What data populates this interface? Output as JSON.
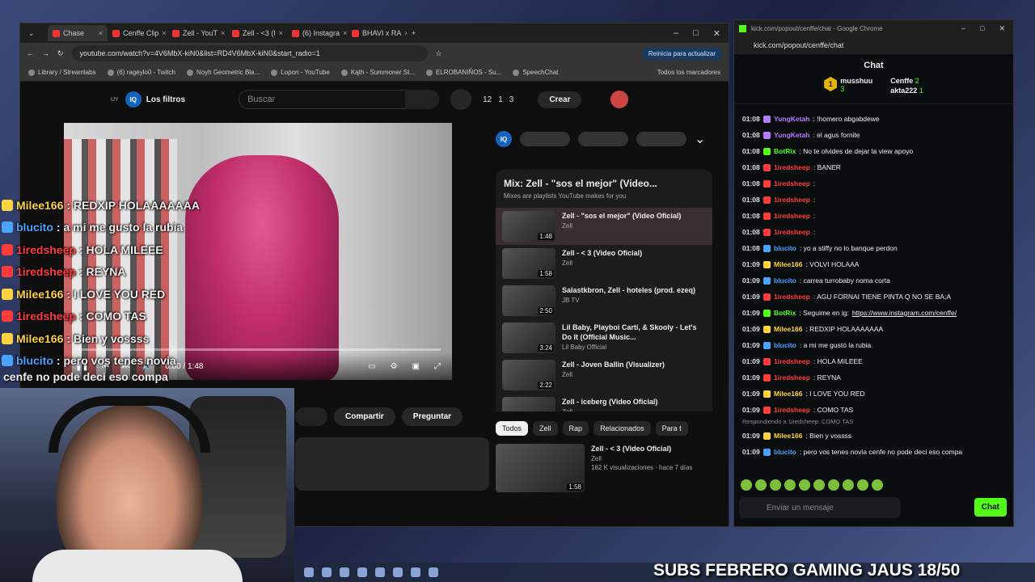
{
  "browser": {
    "tabs": [
      {
        "label": "Chase",
        "active": true
      },
      {
        "label": "Cenffe Clip"
      },
      {
        "label": "Zell - YouT"
      },
      {
        "label": "Zell - <3 (I"
      },
      {
        "label": "(6) Instagra"
      },
      {
        "label": "BHAVI x RA"
      }
    ],
    "url": "youtube.com/watch?v=4V6MbX-kiN0&list=RD4V6MbX-kiN0&start_radio=1",
    "update_button": "Reinicia para actualizar",
    "bookmarks": [
      "Library / Streamlabs",
      "(6) rageylo0 - Twitch",
      "Noyh Geometric Bla...",
      "Lopon - YouTube",
      "Kąth - Summoner St...",
      "ELROBANIÑOS - Su...",
      "SpeechChat"
    ],
    "all_bookmarks": "Todos los marcadores"
  },
  "youtube": {
    "region": "UY",
    "filters_label": "Los filtros",
    "search_placeholder": "Buscar",
    "counters": [
      "12",
      "1",
      "3"
    ],
    "create_label": "Crear",
    "player_time": "0:00 / 1:48",
    "progress": 0.0,
    "share_label": "Compartir",
    "ask_label": "Preguntar",
    "mix_title": "Mix: Zell - \"sos el mejor\" (Video...",
    "mix_sub": "Mixes are playlists YouTube makes for you",
    "playlist": [
      {
        "title": "Zell - \"sos el mejor\" (Video Oficial)",
        "channel": "Zell",
        "duration": "1:48"
      },
      {
        "title": "Zell - < 3 (Video Oficial)",
        "channel": "Zell",
        "duration": "1:58"
      },
      {
        "title": "Salastkbron, Zell - hoteles (prod. ezeq)",
        "channel": "JB TV",
        "duration": "2:50"
      },
      {
        "title": "Lil Baby, Playboi Carti, & Skooly - Let's Do It (Official Music...",
        "channel": "Lil Baby Official",
        "duration": "3:24"
      },
      {
        "title": "Zell - Joven Ballin (Visualizer)",
        "channel": "Zell",
        "duration": "2:22"
      },
      {
        "title": "Zell - iceberg (Video Oficial)",
        "channel": "Zell",
        "duration": ""
      }
    ],
    "chips": [
      "Todos",
      "Zell",
      "Rap",
      "Relacionados",
      "Para t"
    ],
    "rec": {
      "title": "Zell - < 3 (Video Oficial)",
      "channel": "Zell",
      "meta": "162 K visualizaciones · hace 7 días",
      "duration": "1:58"
    }
  },
  "chat": {
    "window_title": "kick.com/popout/cenffe/chat - Google Chrome",
    "url": "kick.com/popout/cenffe/chat",
    "header": "Chat",
    "leaders": [
      {
        "rank": "1",
        "name": "musshuu",
        "count": "3"
      },
      {
        "rank": "",
        "name": "Cenffe",
        "count": "2"
      },
      {
        "rank": "",
        "name": "akta222",
        "count": "1"
      }
    ],
    "messages": [
      {
        "time": "01:08",
        "user": "YungKetah",
        "color": "#b57cff",
        "text": ": !homero abgabdewe"
      },
      {
        "time": "01:08",
        "user": "YungKetah",
        "color": "#b57cff",
        "text": ": el agus fornite"
      },
      {
        "time": "01:08",
        "user": "BotRix",
        "color": "#53fc18",
        "text": ": No te olvides de dejar la view apoyo"
      },
      {
        "time": "01:08",
        "user": "1iredsheep",
        "color": "#ff3b3b",
        "text": ": BANER"
      },
      {
        "time": "01:08",
        "user": "1iredsheep",
        "color": "#ff3b3b",
        "text": ":"
      },
      {
        "time": "01:08",
        "user": "1iredsheep",
        "color": "#ff3b3b",
        "text": ":"
      },
      {
        "time": "01:08",
        "user": "1iredsheep",
        "color": "#ff3b3b",
        "text": ":"
      },
      {
        "time": "01:08",
        "user": "1iredsheep",
        "color": "#ff3b3b",
        "text": ":"
      },
      {
        "time": "01:08",
        "user": "blucito",
        "color": "#4aa3ff",
        "text": ": yo a stiffy no lo banque perdon"
      },
      {
        "time": "01:09",
        "user": "Milee166",
        "color": "#ffd23f",
        "text": ": VOLVI HOLAAA"
      },
      {
        "time": "01:09",
        "user": "blucito",
        "color": "#4aa3ff",
        "text": ": carrea turrobaby noma corta"
      },
      {
        "time": "01:09",
        "user": "1iredsheep",
        "color": "#ff3b3b",
        "text": ": AGU FORNAI TIENE PINTA Q NO SE BA;A"
      },
      {
        "time": "01:09",
        "user": "BotRix",
        "color": "#53fc18",
        "text": ": Seguime en ig:",
        "link": "https://www.instagram.com/cenffe/"
      },
      {
        "time": "01:09",
        "user": "Milee166",
        "color": "#ffd23f",
        "text": ": REDXIP HOLAAAAAAA"
      },
      {
        "time": "01:09",
        "user": "blucito",
        "color": "#4aa3ff",
        "text": ": a mi me gustó la rubia"
      },
      {
        "time": "01:09",
        "user": "1iredsheep",
        "color": "#ff3b3b",
        "text": ": HOLA MILEEE"
      },
      {
        "time": "01:09",
        "user": "1iredsheep",
        "color": "#ff3b3b",
        "text": ": REYNA"
      },
      {
        "time": "01:09",
        "user": "Milee166",
        "color": "#ffd23f",
        "text": ": I LOVE YOU RED"
      },
      {
        "time": "01:09",
        "user": "1iredsheep",
        "color": "#ff3b3b",
        "text": ": COMO TAS"
      }
    ],
    "reply_hint": "Respondiendo a 1iredsheep: COMO TAS",
    "last_messages": [
      {
        "time": "01:09",
        "user": "Milee166",
        "color": "#ffd23f",
        "text": ": Bien y vossss"
      },
      {
        "time": "01:09",
        "user": "blucito",
        "color": "#4aa3ff",
        "text": ": pero vos tenes novia cenfe no pode deci eso compa"
      }
    ],
    "input_placeholder": "Enviar un mensaje",
    "send_label": "Chat"
  },
  "overlay": {
    "lines": [
      {
        "user": "Milee166",
        "color": "#ffd23f",
        "text": " : REDXIP HOLAAAAAAA"
      },
      {
        "user": "blucito",
        "color": "#4aa3ff",
        "text": " : a mi me gusto la rubia"
      },
      {
        "user": "1iredsheep",
        "color": "#ff3b3b",
        "text": " : HOLA MILEEE"
      },
      {
        "user": "1iredsheep",
        "color": "#ff3b3b",
        "text": " : REYNA"
      },
      {
        "user": "Milee166",
        "color": "#ffd23f",
        "text": " : I LOVE YOU RED"
      },
      {
        "user": "1iredsheep",
        "color": "#ff3b3b",
        "text": " : COMO TAS"
      },
      {
        "user": "Milee166",
        "color": "#ffd23f",
        "text": " : Bien y vossss"
      },
      {
        "user": "blucito",
        "color": "#4aa3ff",
        "text": " : pero vos tenes novia"
      }
    ],
    "tail": "cenfe no pode deci eso compa"
  },
  "stream_banner": "SUBS FEBRERO GAMING JAUS 18/50"
}
